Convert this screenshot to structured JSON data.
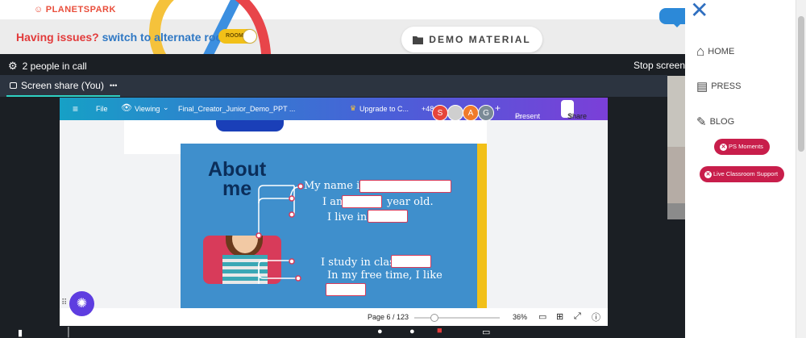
{
  "header": {
    "logo_text": "PLANETSPARK",
    "issues_text": "Having issues?",
    "switch_text": "switch to alternate room",
    "room_toggle_label": "ROOM",
    "demo_material_label": "DEMO MATERIAL"
  },
  "call": {
    "people_count": "2 people in call",
    "stop_screen": "Stop screen",
    "screen_share_tab": "Screen share (You)",
    "more": "•••"
  },
  "canva": {
    "file": "File",
    "viewing": "Viewing",
    "doc_title": "Final_Creator_Junior_Demo_PPT ...",
    "upgrade": "Upgrade to C...",
    "extra_people": "+48",
    "avatars": [
      {
        "letter": "S",
        "color": "#e6453a"
      },
      {
        "letter": "A",
        "color": "#f07b2a"
      },
      {
        "letter": "G",
        "color": "#7a8a96"
      }
    ],
    "present": "Present",
    "share": "Share",
    "page": "Page 6 / 123",
    "zoom": "36%",
    "zoom_level": 0.19
  },
  "slide": {
    "title_line1": "About",
    "title_line2": "me",
    "lines": [
      "My name is",
      "I am",
      "year old.",
      "I live in",
      "I study in class",
      "In my free time, I like"
    ]
  },
  "sidebar": {
    "home": "HOME",
    "press": "PRESS",
    "blog": "BLOG",
    "ps_moments": "PS Moments",
    "live_support": "Live Classroom Support"
  },
  "colors": {
    "accent_red": "#c81e4b",
    "slide_blue": "#3f8fcc",
    "canva_purple": "#7b3fd8"
  }
}
